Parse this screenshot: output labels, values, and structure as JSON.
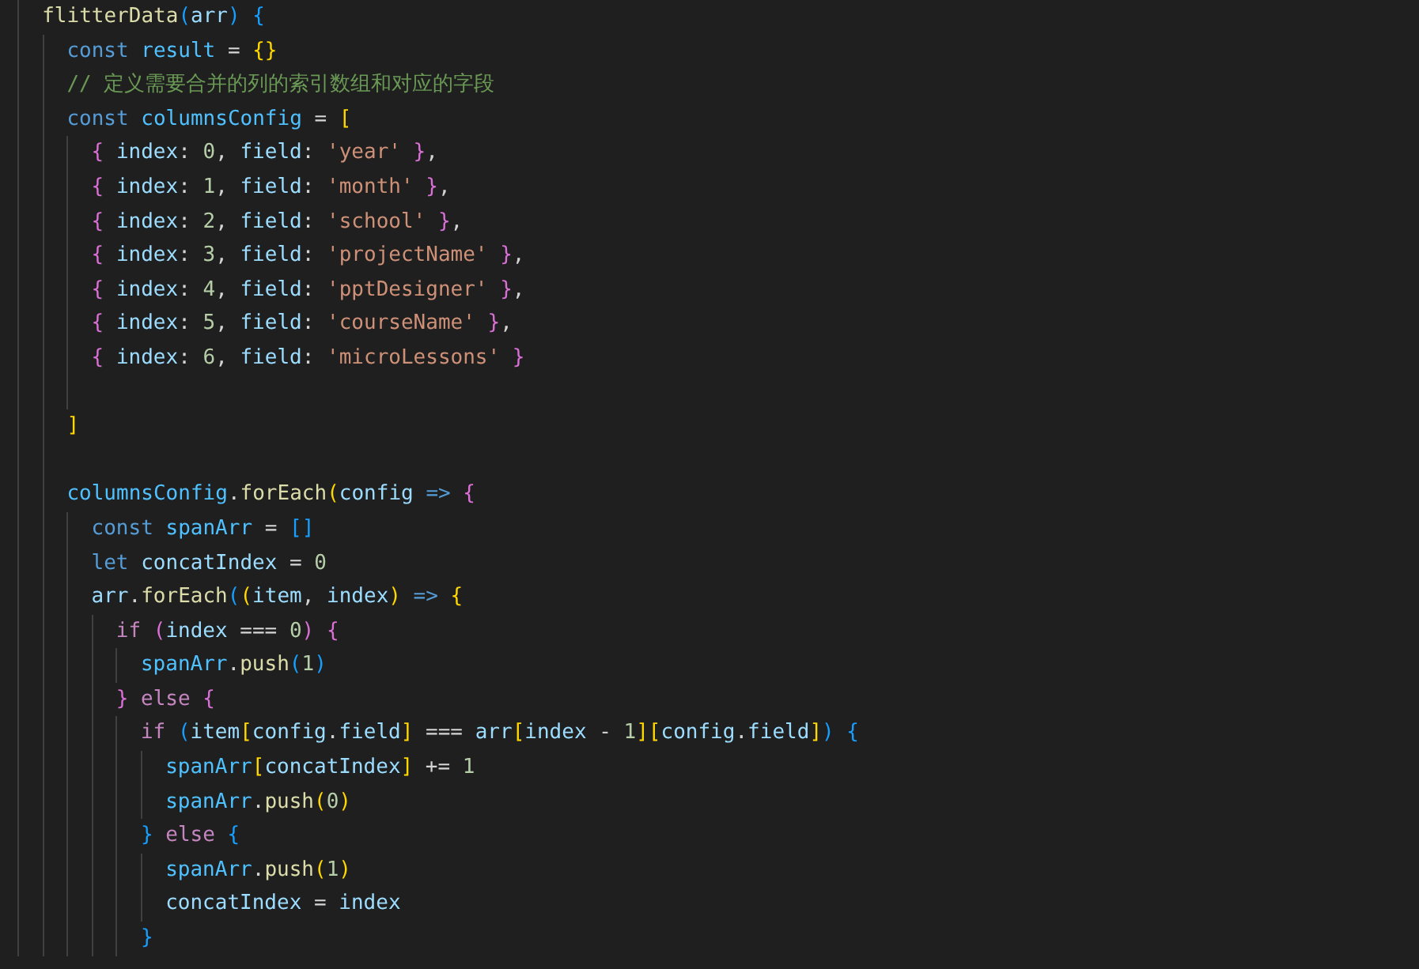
{
  "editor": {
    "lines": [
      {
        "kind": "code",
        "tokens": [
          {
            "text": "flitterData",
            "kind": "fn"
          },
          {
            "text": "(",
            "kind": "b3"
          },
          {
            "text": "arr",
            "kind": "var"
          },
          {
            "text": ") {",
            "kind": "b3"
          }
        ],
        "children": [
          {
            "kind": "code",
            "tokens": [
              {
                "text": "const ",
                "kind": "kw"
              },
              {
                "text": "result",
                "kind": "cst"
              },
              {
                "text": " = ",
                "kind": "plain"
              },
              {
                "text": "{}",
                "kind": "b1"
              }
            ]
          },
          {
            "kind": "code",
            "tokens": [
              {
                "text": "// 定义需要合并的列的索引数组和对应的字段",
                "kind": "cmt"
              }
            ]
          },
          {
            "kind": "code",
            "tokens": [
              {
                "text": "const ",
                "kind": "kw"
              },
              {
                "text": "columnsConfig",
                "kind": "cst"
              },
              {
                "text": " = ",
                "kind": "plain"
              },
              {
                "text": "[",
                "kind": "b1"
              }
            ],
            "children": [
              {
                "kind": "code",
                "tokens": [
                  {
                    "text": "{ ",
                    "kind": "b2"
                  },
                  {
                    "text": "index",
                    "kind": "var"
                  },
                  {
                    "text": ": ",
                    "kind": "plain"
                  },
                  {
                    "text": "0",
                    "kind": "num"
                  },
                  {
                    "text": ", ",
                    "kind": "plain"
                  },
                  {
                    "text": "field",
                    "kind": "var"
                  },
                  {
                    "text": ": ",
                    "kind": "plain"
                  },
                  {
                    "text": "'year'",
                    "kind": "str"
                  },
                  {
                    "text": " }",
                    "kind": "b2"
                  },
                  {
                    "text": ",",
                    "kind": "plain"
                  }
                ]
              },
              {
                "kind": "code",
                "tokens": [
                  {
                    "text": "{ ",
                    "kind": "b2"
                  },
                  {
                    "text": "index",
                    "kind": "var"
                  },
                  {
                    "text": ": ",
                    "kind": "plain"
                  },
                  {
                    "text": "1",
                    "kind": "num"
                  },
                  {
                    "text": ", ",
                    "kind": "plain"
                  },
                  {
                    "text": "field",
                    "kind": "var"
                  },
                  {
                    "text": ": ",
                    "kind": "plain"
                  },
                  {
                    "text": "'month'",
                    "kind": "str"
                  },
                  {
                    "text": " }",
                    "kind": "b2"
                  },
                  {
                    "text": ",",
                    "kind": "plain"
                  }
                ]
              },
              {
                "kind": "code",
                "tokens": [
                  {
                    "text": "{ ",
                    "kind": "b2"
                  },
                  {
                    "text": "index",
                    "kind": "var"
                  },
                  {
                    "text": ": ",
                    "kind": "plain"
                  },
                  {
                    "text": "2",
                    "kind": "num"
                  },
                  {
                    "text": ", ",
                    "kind": "plain"
                  },
                  {
                    "text": "field",
                    "kind": "var"
                  },
                  {
                    "text": ": ",
                    "kind": "plain"
                  },
                  {
                    "text": "'school'",
                    "kind": "str"
                  },
                  {
                    "text": " }",
                    "kind": "b2"
                  },
                  {
                    "text": ",",
                    "kind": "plain"
                  }
                ]
              },
              {
                "kind": "code",
                "tokens": [
                  {
                    "text": "{ ",
                    "kind": "b2"
                  },
                  {
                    "text": "index",
                    "kind": "var"
                  },
                  {
                    "text": ": ",
                    "kind": "plain"
                  },
                  {
                    "text": "3",
                    "kind": "num"
                  },
                  {
                    "text": ", ",
                    "kind": "plain"
                  },
                  {
                    "text": "field",
                    "kind": "var"
                  },
                  {
                    "text": ": ",
                    "kind": "plain"
                  },
                  {
                    "text": "'projectName'",
                    "kind": "str"
                  },
                  {
                    "text": " }",
                    "kind": "b2"
                  },
                  {
                    "text": ",",
                    "kind": "plain"
                  }
                ]
              },
              {
                "kind": "code",
                "tokens": [
                  {
                    "text": "{ ",
                    "kind": "b2"
                  },
                  {
                    "text": "index",
                    "kind": "var"
                  },
                  {
                    "text": ": ",
                    "kind": "plain"
                  },
                  {
                    "text": "4",
                    "kind": "num"
                  },
                  {
                    "text": ", ",
                    "kind": "plain"
                  },
                  {
                    "text": "field",
                    "kind": "var"
                  },
                  {
                    "text": ": ",
                    "kind": "plain"
                  },
                  {
                    "text": "'pptDesigner'",
                    "kind": "str"
                  },
                  {
                    "text": " }",
                    "kind": "b2"
                  },
                  {
                    "text": ",",
                    "kind": "plain"
                  }
                ]
              },
              {
                "kind": "code",
                "tokens": [
                  {
                    "text": "{ ",
                    "kind": "b2"
                  },
                  {
                    "text": "index",
                    "kind": "var"
                  },
                  {
                    "text": ": ",
                    "kind": "plain"
                  },
                  {
                    "text": "5",
                    "kind": "num"
                  },
                  {
                    "text": ", ",
                    "kind": "plain"
                  },
                  {
                    "text": "field",
                    "kind": "var"
                  },
                  {
                    "text": ": ",
                    "kind": "plain"
                  },
                  {
                    "text": "'courseName'",
                    "kind": "str"
                  },
                  {
                    "text": " }",
                    "kind": "b2"
                  },
                  {
                    "text": ",",
                    "kind": "plain"
                  }
                ]
              },
              {
                "kind": "code",
                "tokens": [
                  {
                    "text": "{ ",
                    "kind": "b2"
                  },
                  {
                    "text": "index",
                    "kind": "var"
                  },
                  {
                    "text": ": ",
                    "kind": "plain"
                  },
                  {
                    "text": "6",
                    "kind": "num"
                  },
                  {
                    "text": ", ",
                    "kind": "plain"
                  },
                  {
                    "text": "field",
                    "kind": "var"
                  },
                  {
                    "text": ": ",
                    "kind": "plain"
                  },
                  {
                    "text": "'microLessons'",
                    "kind": "str"
                  },
                  {
                    "text": " }",
                    "kind": "b2"
                  }
                ]
              },
              {
                "kind": "blank"
              }
            ]
          },
          {
            "kind": "code",
            "tokens": [
              {
                "text": "]",
                "kind": "b1"
              }
            ]
          },
          {
            "kind": "blank"
          },
          {
            "kind": "code",
            "tokens": [
              {
                "text": "columnsConfig",
                "kind": "cst"
              },
              {
                "text": ".",
                "kind": "plain"
              },
              {
                "text": "forEach",
                "kind": "fn"
              },
              {
                "text": "(",
                "kind": "b1"
              },
              {
                "text": "config ",
                "kind": "var"
              },
              {
                "text": "=> ",
                "kind": "kw"
              },
              {
                "text": "{",
                "kind": "b2"
              }
            ],
            "children": [
              {
                "kind": "code",
                "tokens": [
                  {
                    "text": "const ",
                    "kind": "kw"
                  },
                  {
                    "text": "spanArr",
                    "kind": "cst"
                  },
                  {
                    "text": " = ",
                    "kind": "plain"
                  },
                  {
                    "text": "[]",
                    "kind": "b3"
                  }
                ]
              },
              {
                "kind": "code",
                "tokens": [
                  {
                    "text": "let ",
                    "kind": "kw"
                  },
                  {
                    "text": "concatIndex",
                    "kind": "var"
                  },
                  {
                    "text": " = ",
                    "kind": "plain"
                  },
                  {
                    "text": "0",
                    "kind": "num"
                  }
                ]
              },
              {
                "kind": "code",
                "tokens": [
                  {
                    "text": "arr",
                    "kind": "var"
                  },
                  {
                    "text": ".",
                    "kind": "plain"
                  },
                  {
                    "text": "forEach",
                    "kind": "fn"
                  },
                  {
                    "text": "(",
                    "kind": "b3"
                  },
                  {
                    "text": "(",
                    "kind": "b1"
                  },
                  {
                    "text": "item",
                    "kind": "var"
                  },
                  {
                    "text": ", ",
                    "kind": "plain"
                  },
                  {
                    "text": "index",
                    "kind": "var"
                  },
                  {
                    "text": ")",
                    "kind": "b1"
                  },
                  {
                    "text": " => ",
                    "kind": "kw"
                  },
                  {
                    "text": "{",
                    "kind": "b1"
                  }
                ],
                "children": [
                  {
                    "kind": "code",
                    "tokens": [
                      {
                        "text": "if ",
                        "kind": "ctrl"
                      },
                      {
                        "text": "(",
                        "kind": "b2"
                      },
                      {
                        "text": "index",
                        "kind": "var"
                      },
                      {
                        "text": " === ",
                        "kind": "plain"
                      },
                      {
                        "text": "0",
                        "kind": "num"
                      },
                      {
                        "text": ") {",
                        "kind": "b2"
                      }
                    ],
                    "children": [
                      {
                        "kind": "code",
                        "tokens": [
                          {
                            "text": "spanArr",
                            "kind": "cst"
                          },
                          {
                            "text": ".",
                            "kind": "plain"
                          },
                          {
                            "text": "push",
                            "kind": "fn"
                          },
                          {
                            "text": "(",
                            "kind": "b3"
                          },
                          {
                            "text": "1",
                            "kind": "num"
                          },
                          {
                            "text": ")",
                            "kind": "b3"
                          }
                        ]
                      }
                    ]
                  },
                  {
                    "kind": "code",
                    "tokens": [
                      {
                        "text": "} ",
                        "kind": "b2"
                      },
                      {
                        "text": "else ",
                        "kind": "ctrl"
                      },
                      {
                        "text": "{",
                        "kind": "b2"
                      }
                    ],
                    "children": [
                      {
                        "kind": "code",
                        "tokens": [
                          {
                            "text": "if ",
                            "kind": "ctrl"
                          },
                          {
                            "text": "(",
                            "kind": "b3"
                          },
                          {
                            "text": "item",
                            "kind": "var"
                          },
                          {
                            "text": "[",
                            "kind": "b1"
                          },
                          {
                            "text": "config",
                            "kind": "var"
                          },
                          {
                            "text": ".",
                            "kind": "plain"
                          },
                          {
                            "text": "field",
                            "kind": "var"
                          },
                          {
                            "text": "]",
                            "kind": "b1"
                          },
                          {
                            "text": " === ",
                            "kind": "plain"
                          },
                          {
                            "text": "arr",
                            "kind": "var"
                          },
                          {
                            "text": "[",
                            "kind": "b1"
                          },
                          {
                            "text": "index",
                            "kind": "var"
                          },
                          {
                            "text": " - ",
                            "kind": "plain"
                          },
                          {
                            "text": "1",
                            "kind": "num"
                          },
                          {
                            "text": "][",
                            "kind": "b1"
                          },
                          {
                            "text": "config",
                            "kind": "var"
                          },
                          {
                            "text": ".",
                            "kind": "plain"
                          },
                          {
                            "text": "field",
                            "kind": "var"
                          },
                          {
                            "text": "]",
                            "kind": "b1"
                          },
                          {
                            "text": ") {",
                            "kind": "b3"
                          }
                        ],
                        "children": [
                          {
                            "kind": "code",
                            "tokens": [
                              {
                                "text": "spanArr",
                                "kind": "cst"
                              },
                              {
                                "text": "[",
                                "kind": "b1"
                              },
                              {
                                "text": "concatIndex",
                                "kind": "var"
                              },
                              {
                                "text": "]",
                                "kind": "b1"
                              },
                              {
                                "text": " += ",
                                "kind": "plain"
                              },
                              {
                                "text": "1",
                                "kind": "num"
                              }
                            ]
                          },
                          {
                            "kind": "code",
                            "tokens": [
                              {
                                "text": "spanArr",
                                "kind": "cst"
                              },
                              {
                                "text": ".",
                                "kind": "plain"
                              },
                              {
                                "text": "push",
                                "kind": "fn"
                              },
                              {
                                "text": "(",
                                "kind": "b1"
                              },
                              {
                                "text": "0",
                                "kind": "num"
                              },
                              {
                                "text": ")",
                                "kind": "b1"
                              }
                            ]
                          }
                        ]
                      },
                      {
                        "kind": "code",
                        "tokens": [
                          {
                            "text": "} ",
                            "kind": "b3"
                          },
                          {
                            "text": "else ",
                            "kind": "ctrl"
                          },
                          {
                            "text": "{",
                            "kind": "b3"
                          }
                        ],
                        "children": [
                          {
                            "kind": "code",
                            "tokens": [
                              {
                                "text": "spanArr",
                                "kind": "cst"
                              },
                              {
                                "text": ".",
                                "kind": "plain"
                              },
                              {
                                "text": "push",
                                "kind": "fn"
                              },
                              {
                                "text": "(",
                                "kind": "b1"
                              },
                              {
                                "text": "1",
                                "kind": "num"
                              },
                              {
                                "text": ")",
                                "kind": "b1"
                              }
                            ]
                          },
                          {
                            "kind": "code",
                            "tokens": [
                              {
                                "text": "concatIndex",
                                "kind": "var"
                              },
                              {
                                "text": " = ",
                                "kind": "plain"
                              },
                              {
                                "text": "index",
                                "kind": "var"
                              }
                            ]
                          }
                        ]
                      },
                      {
                        "kind": "code",
                        "tokens": [
                          {
                            "text": "}",
                            "kind": "b3"
                          }
                        ]
                      }
                    ]
                  }
                ]
              }
            ]
          }
        ]
      }
    ]
  }
}
